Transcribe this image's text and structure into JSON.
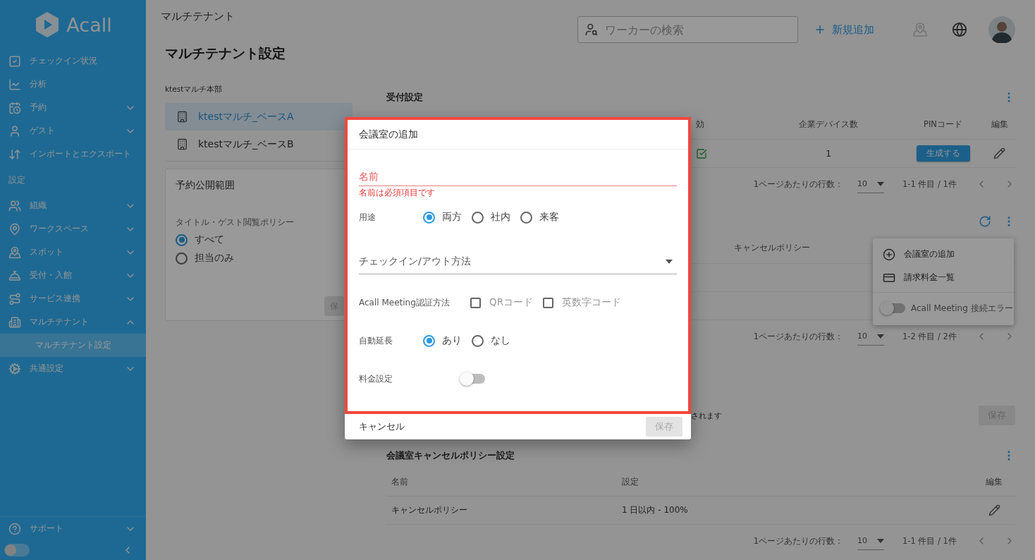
{
  "sidebar": {
    "logo": "Acall",
    "nav": [
      {
        "label": "チェックイン状況"
      },
      {
        "label": "分析"
      },
      {
        "label": "予約",
        "expanded": false
      },
      {
        "label": "ゲスト",
        "expanded": false
      },
      {
        "label": "インポートとエクスポート"
      }
    ],
    "section_label": "設定",
    "settings": [
      {
        "label": "組織",
        "expanded": false
      },
      {
        "label": "ワークスペース",
        "expanded": false
      },
      {
        "label": "スポット",
        "expanded": false
      },
      {
        "label": "受付・入館",
        "expanded": false
      },
      {
        "label": "サービス連携",
        "expanded": false
      },
      {
        "label": "マルチテナント",
        "expanded": true,
        "children": [
          {
            "label": "マルチテナント設定",
            "selected": true
          }
        ]
      },
      {
        "label": "共通設定",
        "expanded": false
      }
    ],
    "footer": [
      {
        "label": "サポート",
        "expanded": false
      }
    ],
    "theme_toggle": {
      "on": false
    }
  },
  "header": {
    "breadcrumb": "マルチテナント",
    "search": {
      "placeholder": "ワーカーの検索"
    },
    "add_button": "新規追加"
  },
  "page_title": "マルチテナント設定",
  "tenants": {
    "group": "ktestマルチ本部",
    "items": [
      {
        "label": "ktestマルチ_ベースA",
        "selected": true
      },
      {
        "label": "ktestマルチ_ベースB",
        "selected": false
      }
    ]
  },
  "visibility_card": {
    "title": "予約公開範囲",
    "policy_label": "タイトル・ゲスト閲覧ポリシー",
    "options": [
      {
        "label": "すべて",
        "selected": true
      },
      {
        "label": "担当のみ",
        "selected": false
      }
    ],
    "save_button": {
      "label": "保",
      "disabled": true
    }
  },
  "reception": {
    "title": "受付設定",
    "columns": [
      "効",
      "企業デバイス数",
      "PINコード",
      "編集"
    ],
    "rows": [
      {
        "enabled": true,
        "devices": "1",
        "pin_button": "生成する"
      }
    ],
    "pagination": {
      "rows_label": "1ページあたりの行数：",
      "per_page": "10",
      "range": "1-1 件目 / 1件"
    }
  },
  "rooms": {
    "columns": [
      "キャンセルポリシー"
    ],
    "pagination": {
      "rows_label": "1ページあたりの行数：",
      "per_page": "10",
      "range": "1-2 件目 / 2件"
    },
    "note": "されます",
    "save_button": {
      "label": "保存",
      "disabled": true
    }
  },
  "room_menu": {
    "items": [
      {
        "label": "会議室の追加"
      },
      {
        "label": "請求料金一覧"
      }
    ],
    "toggle": {
      "label": "Acall Meeting 接続エラー",
      "on": false
    }
  },
  "cancel_policy": {
    "title": "会議室キャンセルポリシー設定",
    "columns": [
      "名前",
      "設定",
      "編集"
    ],
    "rows": [
      {
        "name": "キャンセルポリシー",
        "setting": "1 日以内 - 100%"
      }
    ],
    "pagination": {
      "rows_label": "1ページあたりの行数：",
      "per_page": "10",
      "range": "1-1 件目 / 1件"
    }
  },
  "dialog": {
    "title": "会議室の追加",
    "fields": [
      {
        "kind": "text",
        "label": "名前",
        "invalid": true,
        "error": "名前は必須項目です"
      },
      {
        "kind": "radio",
        "label": "用途",
        "options": [
          {
            "label": "両方",
            "selected": true
          },
          {
            "label": "社内",
            "selected": false
          },
          {
            "label": "来客",
            "selected": false
          }
        ]
      },
      {
        "kind": "select",
        "placeholder": "チェックイン/アウト方法"
      },
      {
        "kind": "checkbox",
        "label": "Acall Meeting認証方法",
        "options": [
          {
            "label": "QRコード",
            "checked": false
          },
          {
            "label": "英数字コード",
            "checked": false
          }
        ]
      },
      {
        "kind": "radio",
        "label": "自動延長",
        "options": [
          {
            "label": "あり",
            "selected": true
          },
          {
            "label": "なし",
            "selected": false
          }
        ]
      },
      {
        "kind": "switch",
        "label": "料金設定",
        "on": false
      }
    ],
    "cancel_button": "キャンセル",
    "save_button": {
      "label": "保存",
      "disabled": true
    }
  }
}
